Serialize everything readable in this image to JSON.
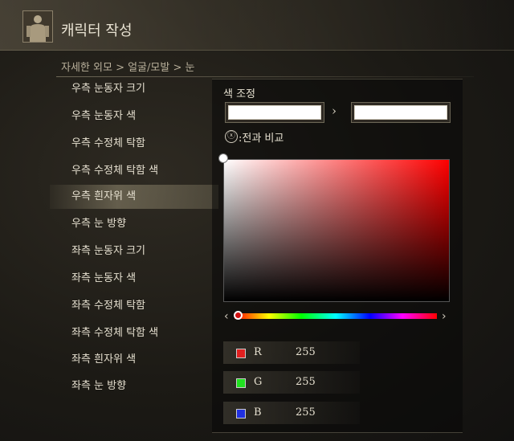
{
  "header": {
    "title": "캐릭터 작성",
    "portrait_icon": "character-portrait"
  },
  "breadcrumb": "자세한 외모 > 얼굴/모발 > 눈",
  "menu": {
    "items": [
      {
        "label": "우측 눈동자 크기"
      },
      {
        "label": "우측 눈동자 색"
      },
      {
        "label": "우측 수정체 탁함"
      },
      {
        "label": "우측 수정체 탁함 색"
      },
      {
        "label": "우측 흰자위 색"
      },
      {
        "label": "우측 눈 방향"
      },
      {
        "label": "좌측 눈동자 크기"
      },
      {
        "label": "좌측 눈동자 색"
      },
      {
        "label": "좌측 수정체 탁함"
      },
      {
        "label": "좌측 수정체 탁함 색"
      },
      {
        "label": "좌측 흰자위 색"
      },
      {
        "label": "좌측 눈 방향"
      }
    ],
    "selected_index": 4
  },
  "color_panel": {
    "title": "색 조정",
    "before_color": "#ffffff",
    "after_color": "#ffffff",
    "compare_button": "ⓧ",
    "compare_label": ":전과 비교",
    "hue_color": "#ff0000",
    "channels": [
      {
        "label": "R",
        "value": "255",
        "color": "#e02020"
      },
      {
        "label": "G",
        "value": "255",
        "color": "#20e020"
      },
      {
        "label": "B",
        "value": "255",
        "color": "#2030e0"
      }
    ]
  }
}
